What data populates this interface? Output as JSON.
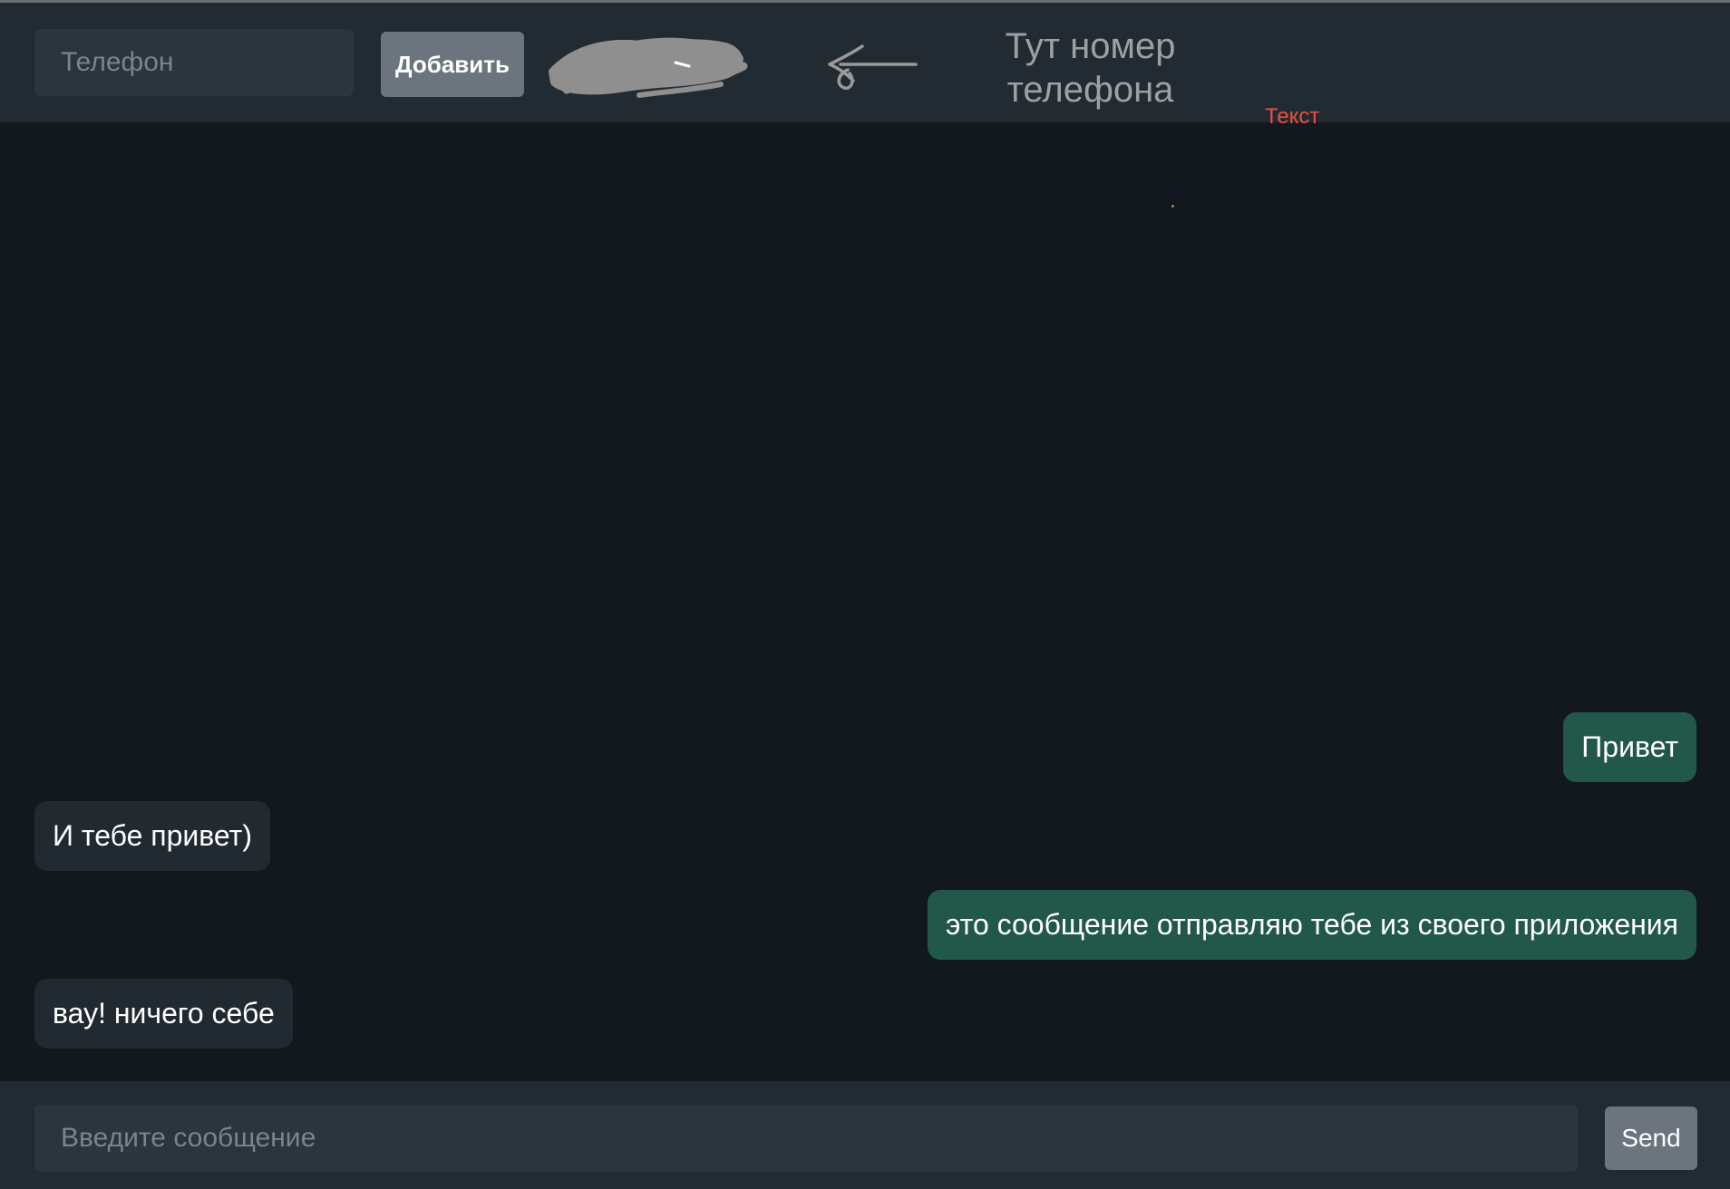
{
  "header": {
    "phone_placeholder": "Телефон",
    "add_label": "Добавить",
    "phone_hint": "Тут номер\nтелефона",
    "red_text": "Текст"
  },
  "messages": [
    {
      "text": "Привет",
      "direction": "outgoing"
    },
    {
      "text": "И тебе привет)",
      "direction": "incoming"
    },
    {
      "text": "это сообщение отправляю тебе из своего приложения",
      "direction": "outgoing"
    },
    {
      "text": "вау! ничего себе",
      "direction": "incoming"
    }
  ],
  "composer": {
    "message_placeholder": "Введите сообщение",
    "send_label": "Send"
  },
  "colors": {
    "background": "#12181d",
    "header": "#232b32",
    "outgoing_bubble": "#22584a",
    "incoming_bubble": "#222a31",
    "button": "#6c757d",
    "annotation_red": "#e8503f"
  },
  "icons": {
    "scribble": "redacted-scribble",
    "arrow": "arrow-left-icon"
  }
}
